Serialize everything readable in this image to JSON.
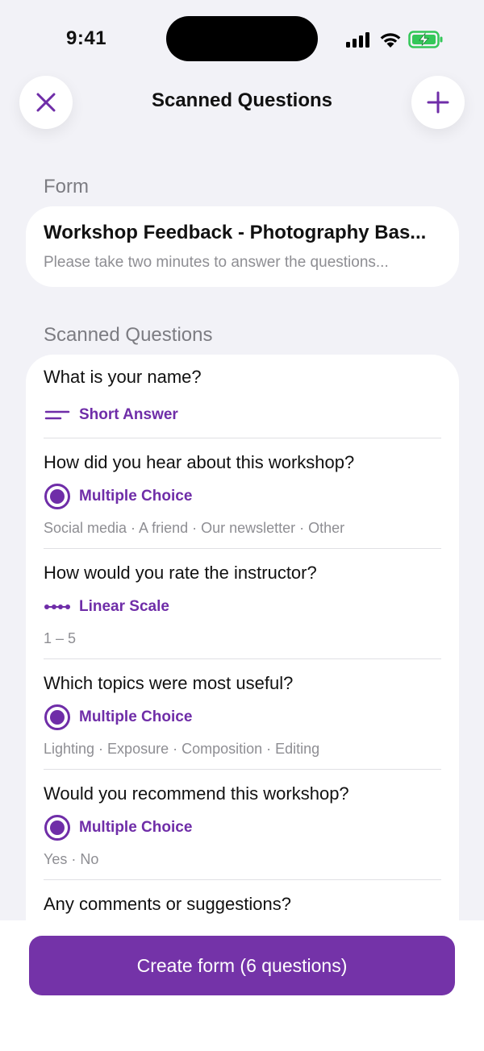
{
  "status_bar": {
    "time": "9:41"
  },
  "nav": {
    "title": "Scanned Questions"
  },
  "form_section": {
    "label": "Form",
    "title": "Workshop Feedback - Photography Bas...",
    "description": "Please take two minutes to answer the questions..."
  },
  "questions_section": {
    "label": "Scanned Questions"
  },
  "questions": [
    {
      "text": "What is your name?",
      "type": "Short Answer",
      "icon": "short-answer-icon",
      "options": ""
    },
    {
      "text": "How did you hear about this workshop?",
      "type": "Multiple Choice",
      "icon": "radio-icon",
      "options": "Social media · A friend · Our newsletter · Other"
    },
    {
      "text": "How would you rate the instructor?",
      "type": "Linear Scale",
      "icon": "linear-scale-icon",
      "options": "1 – 5"
    },
    {
      "text": "Which topics were most useful?",
      "type": "Multiple Choice",
      "icon": "radio-icon",
      "options": "Lighting · Exposure · Composition · Editing"
    },
    {
      "text": "Would you recommend this workshop?",
      "type": "Multiple Choice",
      "icon": "radio-icon",
      "options": "Yes · No"
    },
    {
      "text": "Any comments or suggestions?",
      "type": "",
      "icon": "",
      "options": ""
    }
  ],
  "footer": {
    "create_label": "Create form (6 questions)"
  },
  "colors": {
    "accent": "#7433a8",
    "background": "#f2f2f7",
    "battery": "#34c759"
  }
}
